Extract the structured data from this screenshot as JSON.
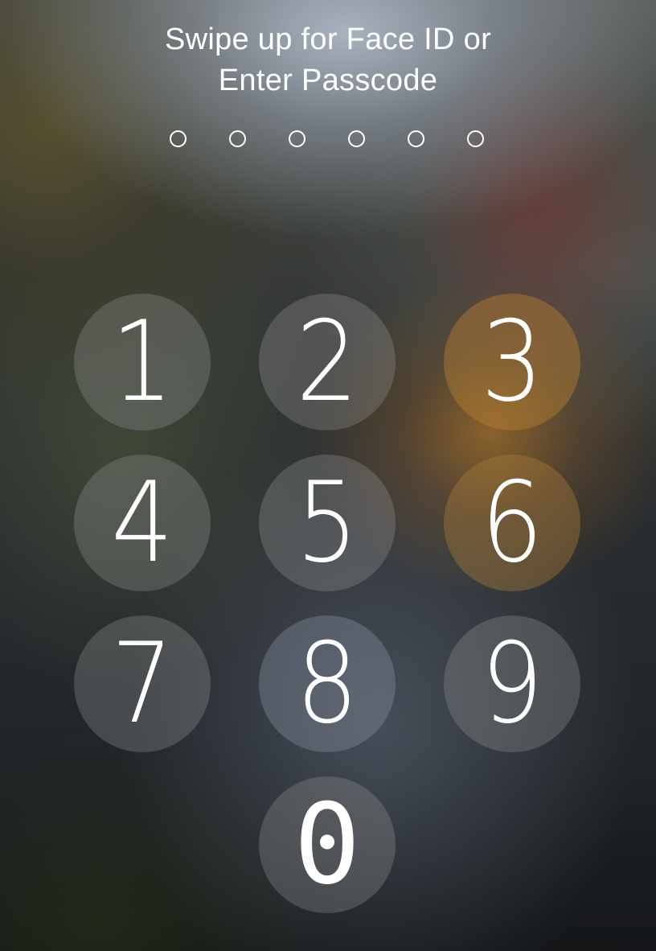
{
  "prompt": {
    "line1": "Swipe up for Face ID or",
    "line2": "Enter Passcode"
  },
  "passcode": {
    "length": 6,
    "entered": 0
  },
  "keypad": {
    "keys": [
      {
        "digit": "1"
      },
      {
        "digit": "2"
      },
      {
        "digit": "3"
      },
      {
        "digit": "4"
      },
      {
        "digit": "5"
      },
      {
        "digit": "6"
      },
      {
        "digit": "7"
      },
      {
        "digit": "8"
      },
      {
        "digit": "9"
      },
      {
        "digit": "0"
      }
    ]
  },
  "colors": {
    "text": "#ffffff",
    "key_fill": "rgba(150,150,150,0.32)"
  }
}
